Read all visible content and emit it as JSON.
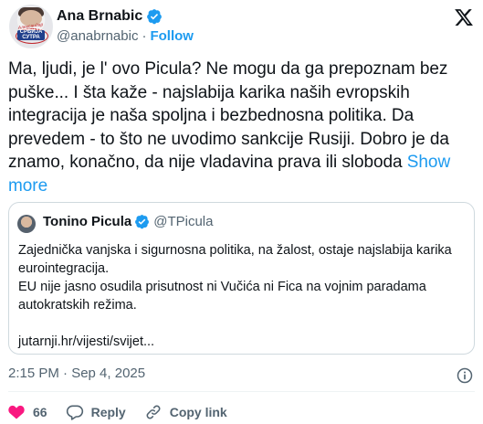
{
  "author": {
    "name": "Ana Brnabic",
    "handle": "@anabrnabic",
    "separator": "·",
    "follow_label": "Follow",
    "avatar_logo_text": "СРБИЈА СУТРА",
    "avatar_arc_text": "Александар Вучић"
  },
  "tweet": {
    "text": "Ma, ljudi, je l' ovo Picula? Ne mogu da ga prepoznam bez puške... I šta kaže - najslabija karika naših evropskih integracija je naša spoljna i bezbednosna politika. Da prevedem - to što ne uvodimo sankcije Rusiji. Dobro je da znamo, konačno, da nije vladavina prava ili sloboda",
    "show_more": "Show more"
  },
  "quote": {
    "name": "Tonino Picula",
    "handle": "@TPicula",
    "line1": "Zajednička vanjska i sigurnosna politika, na žalost, ostaje najslabija karika eurointegracija.",
    "line2": "EU nije jasno osudila prisutnost ni Vučića ni Fica na vojnim paradama autokratskih režima.",
    "link": "jutarnji.hr/vijesti/svijet..."
  },
  "meta": {
    "timestamp": "2:15 PM · Sep 4, 2025"
  },
  "actions": {
    "likes": "66",
    "reply": "Reply",
    "copy_link": "Copy link"
  },
  "colors": {
    "accent": "#1d9bf0",
    "like": "#f91880",
    "muted": "#536471",
    "text": "#0f1419"
  },
  "icons": [
    "verified-badge-icon",
    "x-logo-icon",
    "info-icon",
    "heart-icon",
    "reply-icon",
    "link-icon"
  ]
}
